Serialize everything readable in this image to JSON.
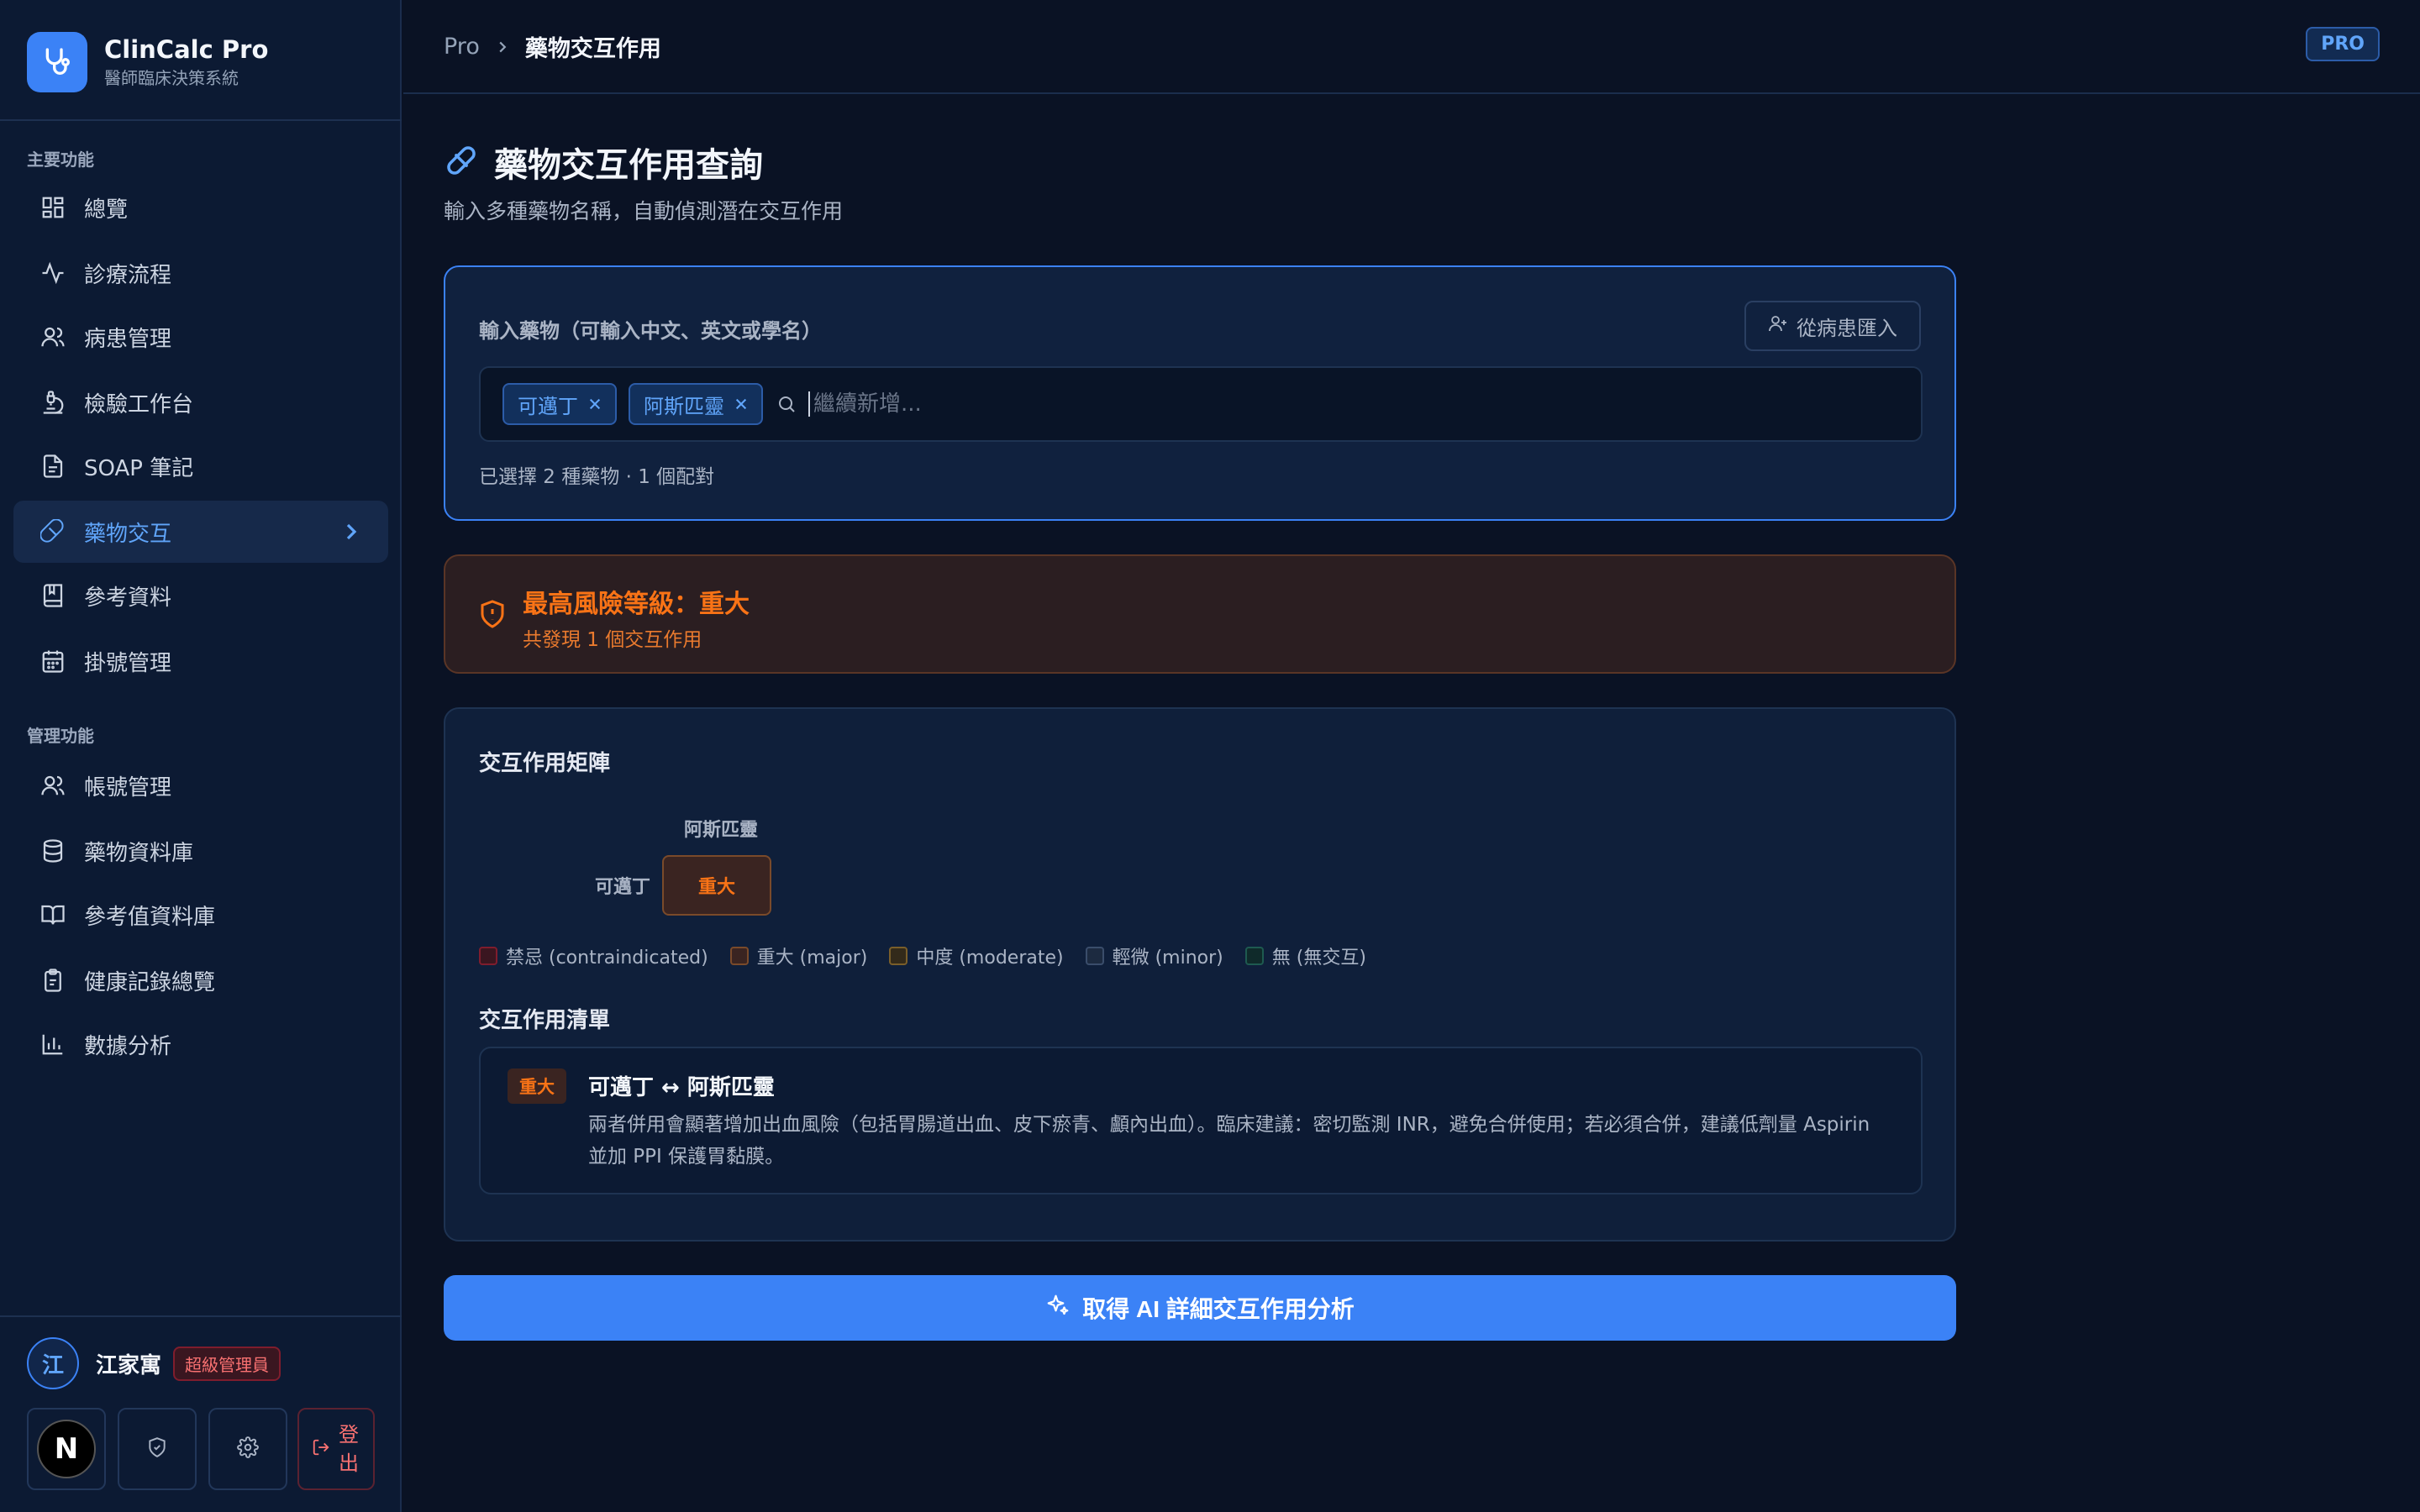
{
  "brand": {
    "name": "ClinCalc Pro",
    "subtitle": "醫師臨床決策系統"
  },
  "sidebar": {
    "section_main": "主要功能",
    "main_items": [
      {
        "label": "總覽",
        "icon": "dashboard-icon"
      },
      {
        "label": "診療流程",
        "icon": "activity-icon"
      },
      {
        "label": "病患管理",
        "icon": "users-icon"
      },
      {
        "label": "檢驗工作台",
        "icon": "microscope-icon"
      },
      {
        "label": "SOAP 筆記",
        "icon": "file-text-icon"
      },
      {
        "label": "藥物交互",
        "icon": "pill-icon",
        "active": true
      },
      {
        "label": "參考資料",
        "icon": "book-icon"
      },
      {
        "label": "掛號管理",
        "icon": "calendar-icon"
      }
    ],
    "section_admin": "管理功能",
    "admin_items": [
      {
        "label": "帳號管理",
        "icon": "users-icon"
      },
      {
        "label": "藥物資料庫",
        "icon": "database-icon"
      },
      {
        "label": "參考值資料庫",
        "icon": "book-open-icon"
      },
      {
        "label": "健康記錄總覽",
        "icon": "clipboard-icon"
      },
      {
        "label": "數據分析",
        "icon": "bar-chart-icon"
      }
    ]
  },
  "user": {
    "avatar_initial": "江",
    "name": "江家寓",
    "role": "超級管理員",
    "brand_initial": "N",
    "logout_label": "登出"
  },
  "topbar": {
    "crumb_root": "Pro",
    "crumb_current": "藥物交互作用",
    "badge": "PRO"
  },
  "page": {
    "title": "藥物交互作用查詢",
    "subtitle": "輸入多種藥物名稱，自動偵測潛在交互作用"
  },
  "drug_input": {
    "label": "輸入藥物（可輸入中文、英文或學名）",
    "import_label": "從病患匯入",
    "tags": [
      "可邁丁",
      "阿斯匹靈"
    ],
    "placeholder": "繼續新增...",
    "count_text": "已選擇 2 種藥物 · 1 個配對"
  },
  "risk": {
    "title": "最高風險等級：重大",
    "subtitle": "共發現 1 個交互作用",
    "color": "#f97316"
  },
  "matrix": {
    "title": "交互作用矩陣",
    "col_header": "阿斯匹靈",
    "row_header": "可邁丁",
    "cell_value": "重大",
    "legend": [
      {
        "label": "禁忌 (contraindicated)",
        "bg": "#3a1620",
        "border": "#7f1d2d"
      },
      {
        "label": "重大 (major)",
        "bg": "#3a2421",
        "border": "#7a4a2a"
      },
      {
        "label": "中度 (moderate)",
        "bg": "#332a1a",
        "border": "#7a5e2a"
      },
      {
        "label": "輕微 (minor)",
        "bg": "#1c2a40",
        "border": "#3a4d6b"
      },
      {
        "label": "無 (無交互)",
        "bg": "#0f2a2a",
        "border": "#1e5a50"
      }
    ]
  },
  "interaction_list": {
    "title": "交互作用清單",
    "items": [
      {
        "severity": "重大",
        "pair": "可邁丁 ↔ 阿斯匹靈",
        "description": "兩者併用會顯著增加出血風險（包括胃腸道出血、皮下瘀青、顱內出血）。臨床建議：密切監測 INR，避免合併使用；若必須合併，建議低劑量 Aspirin 並加 PPI 保護胃黏膜。"
      }
    ]
  },
  "ai_button": {
    "label": "取得 AI 詳細交互作用分析"
  },
  "colors": {
    "accent": "#3b82f6",
    "major": "#f97316",
    "sidebar_bg": "#0c1a33",
    "page_bg": "#0a1224"
  }
}
